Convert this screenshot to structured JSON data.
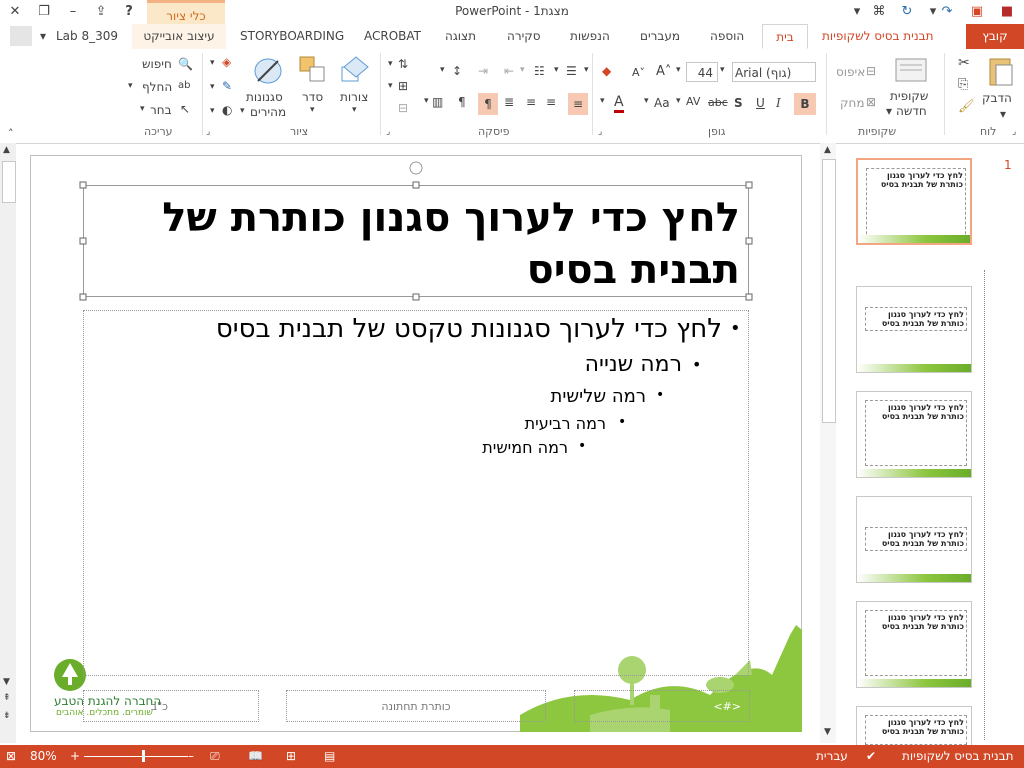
{
  "titlebar": {
    "title": "PowerPoint - מצגת1",
    "context_tab": "כלי ציור",
    "help": "?"
  },
  "tabs": {
    "file": "קובץ",
    "master": "תבנית בסיס לשקופיות",
    "home": "בית",
    "insert": "הוספה",
    "transitions": "מעברים",
    "animations": "הנפשות",
    "review": "סקירה",
    "view": "תצוגה",
    "acrobat": "ACROBAT",
    "storyboarding": "STORYBOARDING",
    "format": "עיצוב אובייקט",
    "user": "Lab 8_309"
  },
  "ribbon": {
    "clipboard": {
      "label": "לוח",
      "paste": "הדבק"
    },
    "slides": {
      "label": "שקופיות",
      "new_slide_1": "שקופית",
      "new_slide_2": "חדשה",
      "reset": "איפוס",
      "delete": "מחק"
    },
    "font": {
      "label": "גופן",
      "font_name": "Arial (גוף)",
      "font_size": "44",
      "bold": "B",
      "italic": "I",
      "underline": "U",
      "shadow": "S",
      "strike": "abc",
      "spacing": "AV",
      "case": "Aa",
      "color": "A"
    },
    "paragraph": {
      "label": "פיסקה"
    },
    "drawing": {
      "label": "ציור",
      "shapes": "צורות",
      "arrange": "סדר",
      "quick_styles_1": "סגנונות",
      "quick_styles_2": "מהירים"
    },
    "editing": {
      "label": "עריכה",
      "find": "חיפוש",
      "replace": "החלף",
      "select": "בחר"
    }
  },
  "slide": {
    "title": "לחץ כדי לערוך סגנון כותרת של תבנית בסיס",
    "level1": "לחץ כדי לערוך סגנונות טקסט של תבנית בסיס",
    "level2": "רמה שנייה",
    "level3": "רמה שלישית",
    "level4": "רמה רביעית",
    "level5": "רמה חמישית",
    "footer": "כותרת תחתונה",
    "date_ph": "כ\"ב",
    "logo_text": "החברה להגנת הטבע",
    "logo_sub": "שומרים. מתכלים. אוהבים",
    "page_ph": "<#>"
  },
  "thumbnails": {
    "first_number": "1",
    "t1": "לחץ כדי לערוך סגנון כותרת של תבנית בסיס",
    "t2": "לחץ כדי לערוך סגנון כותרת של תבנית בסיס",
    "t3": "לחץ כדי לערוך סגנון כותרת של תבנית בסיס",
    "t4": "לחץ כדי לערוך סגנון כותרת של תבנית בסיס",
    "t5": "לחץ כדי לערוך סגנון כותרת של תבנית בסיס",
    "t6": "לחץ כדי לערוך סגנון כותרת של תבנית בסיס"
  },
  "statusbar": {
    "view_name": "תבנית בסיס לשקופיות",
    "language": "עברית",
    "zoom": "80%"
  },
  "colors": {
    "accent": "#d24726",
    "grass": "#8dc63f"
  }
}
